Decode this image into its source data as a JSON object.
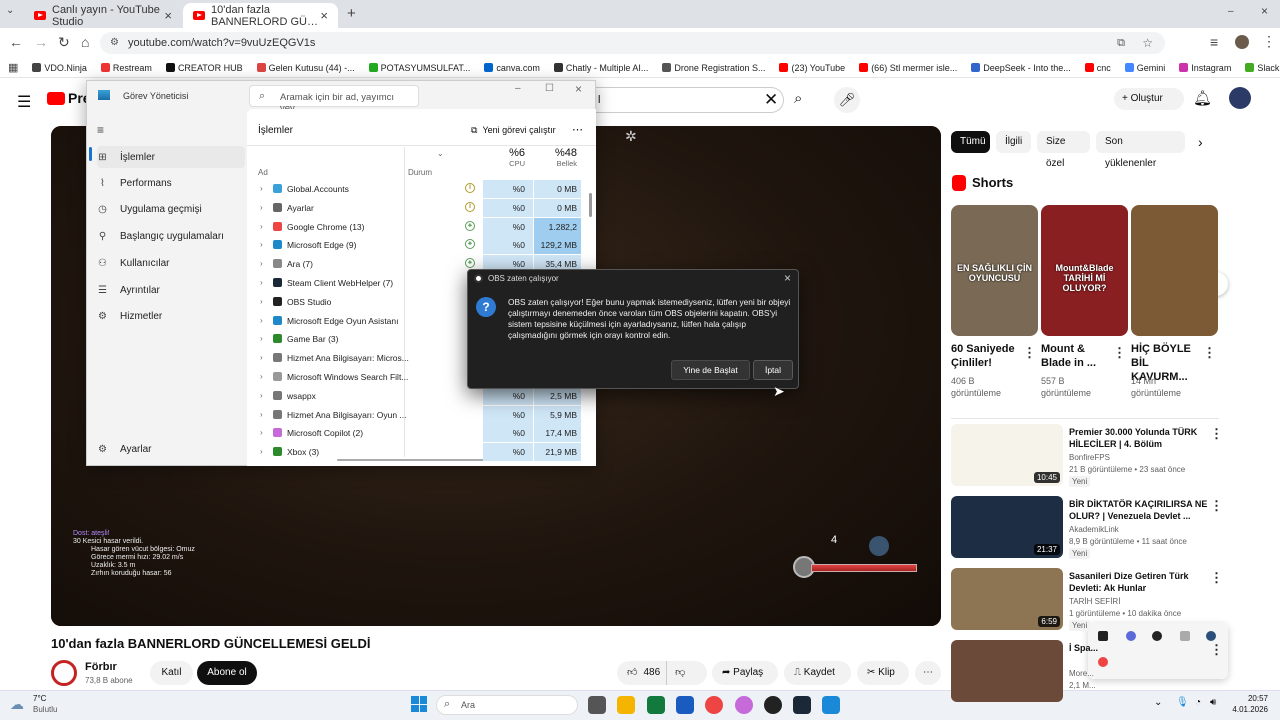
{
  "tabs": [
    {
      "label": "Canlı yayın - YouTube Studio"
    },
    {
      "label": "10'dan fazla BANNERLORD GÜ…"
    }
  ],
  "url": "youtube.com/watch?v=9vuUzEQGV1s",
  "bookmarks": [
    "VDO.Ninja",
    "Restream",
    "CREATOR HUB",
    "Gelen Kutusu (44) -...",
    "POTASYUMSULFAT...",
    "canva.com",
    "Chatly - Multiple AI...",
    "Drone Registration S...",
    "(23) YouTube",
    "(66) Stl mermer isle...",
    "DeepSeek - Into the...",
    "cnc",
    "Gemini",
    "Instagram",
    "Slack"
  ],
  "bookmark_colors": [
    "#444",
    "#e33",
    "#111",
    "#d44",
    "#2a2",
    "#06c",
    "#333",
    "#555",
    "#f00",
    "#f00",
    "#36c",
    "#f00",
    "#48f",
    "#c3a",
    "#4a2"
  ],
  "youtube": {
    "logo_text": "Pre",
    "search_value": "l",
    "create_label": "Oluştur",
    "video_title": "10'dan fazla BANNERLORD GÜNCELLEMESİ GELDİ",
    "channel_name": "Förbır",
    "channel_subs": "73,8 B abone",
    "join_label": "Katıl",
    "subscribe_label": "Abone ol",
    "likes": "486",
    "share_label": "Paylaş",
    "save_label": "Kaydet",
    "clip_label": "Klip",
    "chips": [
      "Tümü",
      "İlgili",
      "Size özel",
      "Son yüklenenler"
    ],
    "shorts_heading": "Shorts",
    "shorts": [
      {
        "title": "60 Saniyede Çinliler!",
        "views": "406 B görüntüleme",
        "thumb_text": "EN SAĞLIKLI ÇİN OYUNCUSU",
        "bg": "#7a6a55"
      },
      {
        "title": "Mount & Blade in ...",
        "views": "557 B görüntüleme",
        "thumb_text": "Mount&Blade TARİHİ Mİ OLUYOR?",
        "bg": "#8a1f22"
      },
      {
        "title": "HİÇ BÖYLE BİL KAVURM...",
        "views": "14 Mn görüntüleme",
        "thumb_text": "",
        "bg": "#7b5a35"
      }
    ],
    "recs": [
      {
        "title": "Premier 30.000 Yolunda TÜRK HİLECİLER | 4. Bölüm",
        "channel": "BonfireFPS",
        "meta": "21 B görüntüleme • 23 saat önce",
        "badge": "Yeni",
        "duration": "10:45",
        "bg": "#f6f3ea"
      },
      {
        "title": "BİR DİKTATÖR KAÇIRILIRSA NE OLUR? | Venezuela Devlet ...",
        "channel": "AkademikLink",
        "meta": "8,9 B görüntüleme • 11 saat önce",
        "badge": "Yeni",
        "duration": "21:37",
        "bg": "#1d2d44"
      },
      {
        "title": "Sasanileri Dize Getiren Türk Devleti: Ak Hunlar",
        "channel": "TARİH SEFİRİ",
        "meta": "1 görüntüleme • 10 dakika önce",
        "badge": "Yeni",
        "duration": "6:59",
        "bg": "#8d7554"
      },
      {
        "title": "İ Spa...",
        "channel": "More...",
        "meta": "2,1 M...",
        "badge": "",
        "duration": "",
        "bg": "#6b4a3a"
      }
    ],
    "video_overlay": [
      "Dost: ateşli!",
      "30 Kesici hasar verildi.",
      "Hasar gören vücut bölgesi: Omuz",
      "Görece mermi hızı: 29.02 m/s",
      "Uzaklık: 3.5 m",
      "Zırhın koruduğu hasar: 56"
    ],
    "ammo_count": "4"
  },
  "taskmanager": {
    "title": "Görev Yöneticisi",
    "search_placeholder": "Aramak için bir ad, yayımcı vey...",
    "nav": [
      {
        "label": "İşlemler",
        "icon": "grid-icon"
      },
      {
        "label": "Performans",
        "icon": "chart-icon"
      },
      {
        "label": "Uygulama geçmişi",
        "icon": "history-icon"
      },
      {
        "label": "Başlangıç uygulamaları",
        "icon": "startup-icon"
      },
      {
        "label": "Kullanıcılar",
        "icon": "users-icon"
      },
      {
        "label": "Ayrıntılar",
        "icon": "list-icon"
      },
      {
        "label": "Hizmetler",
        "icon": "gear-icon"
      }
    ],
    "settings_label": "Ayarlar",
    "section_title": "İşlemler",
    "new_task_label": "Yeni görevi çalıştır",
    "col_name": "Ad",
    "col_status": "Durum",
    "cpu_total": "%6",
    "cpu_label": "CPU",
    "mem_total": "%48",
    "mem_label": "Bellek",
    "rows": [
      {
        "name": "Global.Accounts",
        "cpu": "%0",
        "mem": "0 MB",
        "color": "#3aa0d8",
        "status": "paused"
      },
      {
        "name": "Ayarlar",
        "cpu": "%0",
        "mem": "0 MB",
        "color": "#666",
        "status": "paused"
      },
      {
        "name": "Google Chrome (13)",
        "cpu": "%0",
        "mem": "1.282,2 MB",
        "color": "#e44",
        "status": "leaf"
      },
      {
        "name": "Microsoft Edge (9)",
        "cpu": "%0",
        "mem": "129,2 MB",
        "color": "#1e88c8",
        "status": "leaf"
      },
      {
        "name": "Ara (7)",
        "cpu": "%0",
        "mem": "35,4 MB",
        "color": "#888",
        "status": "leaf"
      },
      {
        "name": "Steam Client WebHelper (7)",
        "cpu": "",
        "mem": "",
        "color": "#1b2838",
        "status": ""
      },
      {
        "name": "OBS Studio",
        "cpu": "",
        "mem": "",
        "color": "#222",
        "status": ""
      },
      {
        "name": "Microsoft Edge Oyun Asistanı",
        "cpu": "",
        "mem": "",
        "color": "#1e88c8",
        "status": ""
      },
      {
        "name": "Game Bar (3)",
        "cpu": "",
        "mem": "",
        "color": "#2c8a2c",
        "status": ""
      },
      {
        "name": "Hizmet Ana Bilgisayarı: Micros...",
        "cpu": "",
        "mem": "",
        "color": "#777",
        "status": ""
      },
      {
        "name": "Microsoft Windows Search Filt...",
        "cpu": "",
        "mem": "",
        "color": "#999",
        "status": ""
      },
      {
        "name": "wsappx",
        "cpu": "%0",
        "mem": "2,5 MB",
        "color": "#777",
        "status": ""
      },
      {
        "name": "Hizmet Ana Bilgisayarı: Oyun ...",
        "cpu": "%0",
        "mem": "5,9 MB",
        "color": "#777",
        "status": ""
      },
      {
        "name": "Microsoft Copilot (2)",
        "cpu": "%0",
        "mem": "17,4 MB",
        "color": "#c56ad8",
        "status": ""
      },
      {
        "name": "Xbox (3)",
        "cpu": "%0",
        "mem": "21,9 MB",
        "color": "#2c8a2c",
        "status": ""
      }
    ]
  },
  "dialog": {
    "title": "OBS zaten çalışıyor",
    "message": "OBS zaten çalışıyor! Eğer bunu yapmak istemediyseniz, lütfen yeni bir objeyi çalıştırmayı denemeden önce varolan tüm OBS objelerini kapatın. OBS'yi sistem tepsisine küçülmesi için ayarladıysanız, lütfen hala çalışıp çalışmadığını görmek için orayı kontrol edin.",
    "launch_label": "Yine de Başlat",
    "cancel_label": "İptal"
  },
  "taskbar": {
    "weather_temp": "7°C",
    "weather_desc": "Bulutlu",
    "search_placeholder": "Ara",
    "time": "20:57",
    "date": "4.01.2026"
  }
}
